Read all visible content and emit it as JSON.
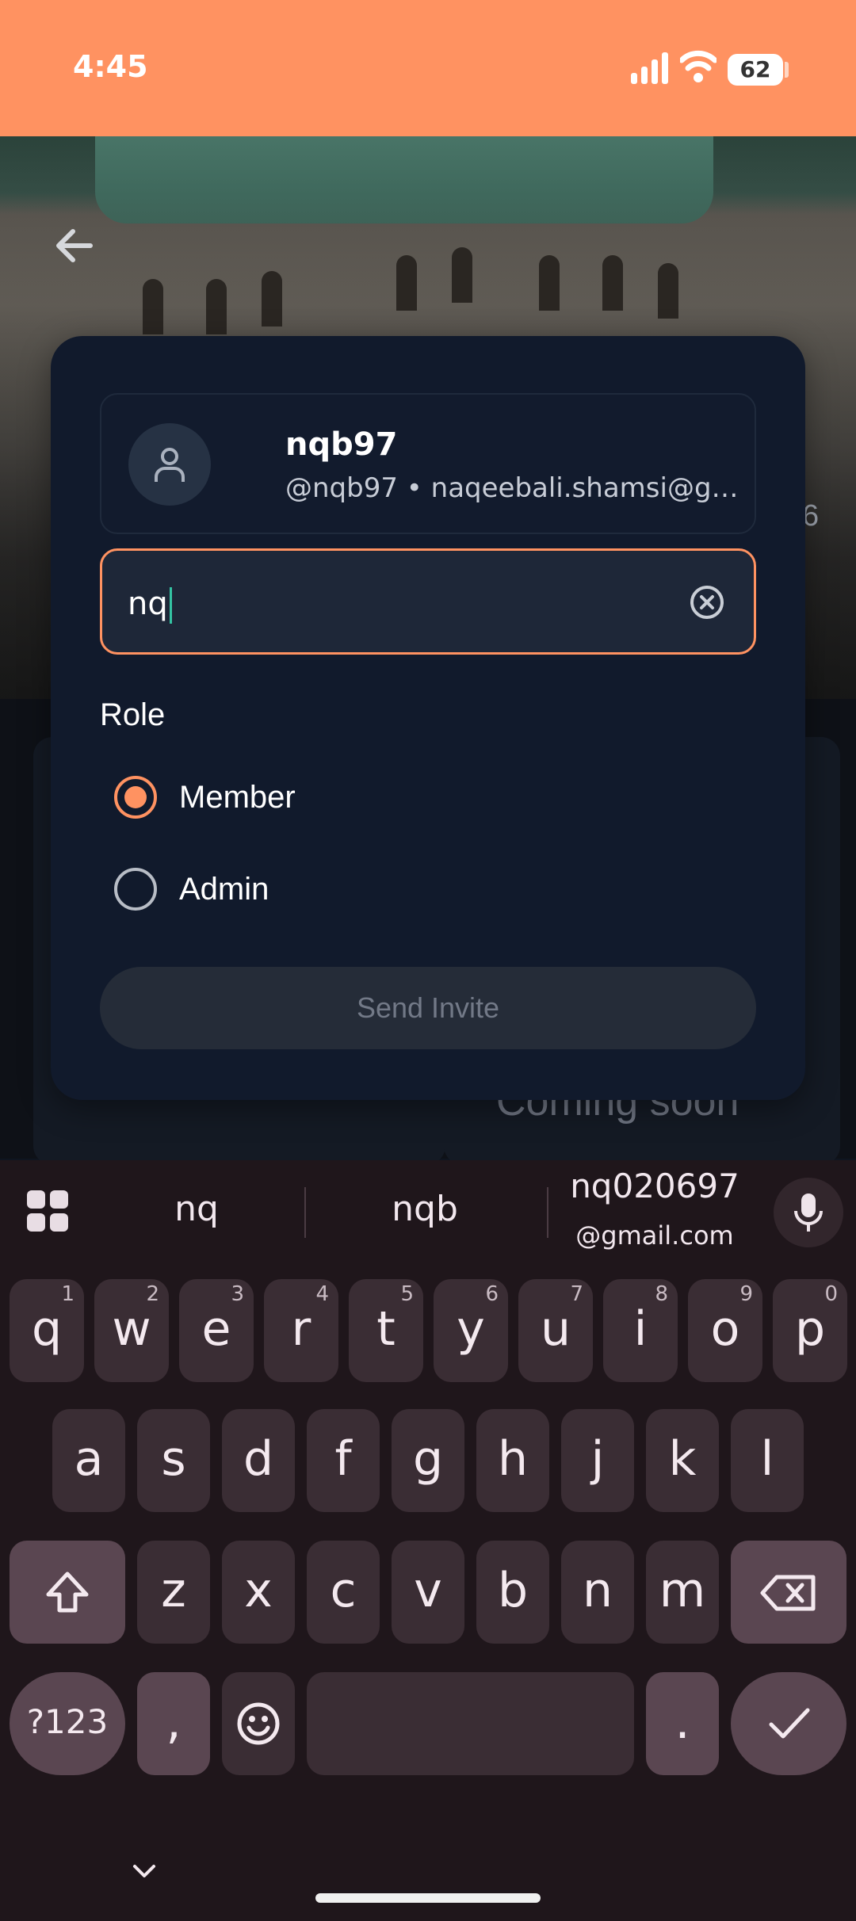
{
  "status_bar": {
    "time": "4:45",
    "battery": "62"
  },
  "background": {
    "coming_soon": "Coming soon",
    "edge_number": "6"
  },
  "dialog": {
    "user": {
      "name": "nqb97",
      "subtitle": "@nqb97 • naqeebali.shamsi@gmail...."
    },
    "search": {
      "value": "nq"
    },
    "role_label": "Role",
    "roles": [
      {
        "label": "Member",
        "selected": true
      },
      {
        "label": "Admin",
        "selected": false
      }
    ],
    "send_button": "Send Invite"
  },
  "keyboard": {
    "suggestions": [
      "nq",
      "nqb",
      "nq020697",
      "@gmail.com"
    ],
    "row1": [
      {
        "k": "q",
        "h": "1"
      },
      {
        "k": "w",
        "h": "2"
      },
      {
        "k": "e",
        "h": "3"
      },
      {
        "k": "r",
        "h": "4"
      },
      {
        "k": "t",
        "h": "5"
      },
      {
        "k": "y",
        "h": "6"
      },
      {
        "k": "u",
        "h": "7"
      },
      {
        "k": "i",
        "h": "8"
      },
      {
        "k": "o",
        "h": "9"
      },
      {
        "k": "p",
        "h": "0"
      }
    ],
    "row2": [
      "a",
      "s",
      "d",
      "f",
      "g",
      "h",
      "j",
      "k",
      "l"
    ],
    "row3": [
      "z",
      "x",
      "c",
      "v",
      "b",
      "n",
      "m"
    ],
    "symbols_key": "?123",
    "comma_key": ",",
    "period_key": "."
  },
  "colors": {
    "accent": "#ff9261",
    "dialog_bg": "#111a2c",
    "keyboard_bg": "#1f161b",
    "cursor": "#34c3a3"
  }
}
